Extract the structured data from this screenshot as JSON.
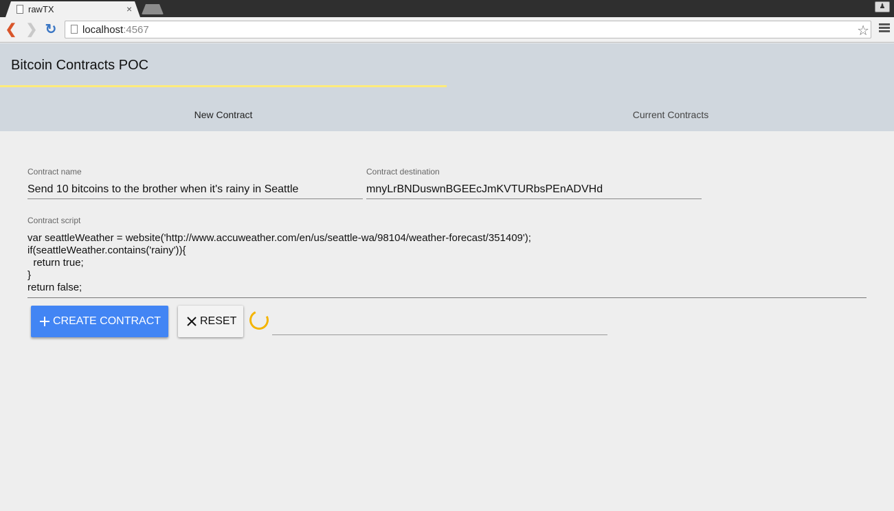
{
  "browser": {
    "tab_title": "rawTX",
    "tab_close": "×",
    "url_host": "localhost",
    "url_port": ":4567"
  },
  "app": {
    "title": "Bitcoin Contracts POC",
    "tabs": [
      {
        "label": "New Contract",
        "active": true
      },
      {
        "label": "Current Contracts",
        "active": false
      }
    ]
  },
  "form": {
    "name_label": "Contract name",
    "name_value": "Send 10 bitcoins to the brother when it's rainy in Seattle",
    "destination_label": "Contract destination",
    "destination_value": "mnyLrBNDuswnBGEEcJmKVTURbsPEnADVHd",
    "script_label": "Contract script",
    "script_lines": [
      "var seattleWeather = website('http://www.accuweather.com/en/us/seattle-wa/98104/weather-forecast/351409');",
      "if(seattleWeather.contains('rainy')){",
      "  return true;",
      "}",
      "return false;"
    ]
  },
  "actions": {
    "create_label": "CREATE CONTRACT",
    "reset_label": "RESET"
  },
  "colors": {
    "primary": "#4285f4",
    "spinner": "#f4b400",
    "tab_ink": "#ffeb7a",
    "header_bg": "#d0d7de"
  }
}
